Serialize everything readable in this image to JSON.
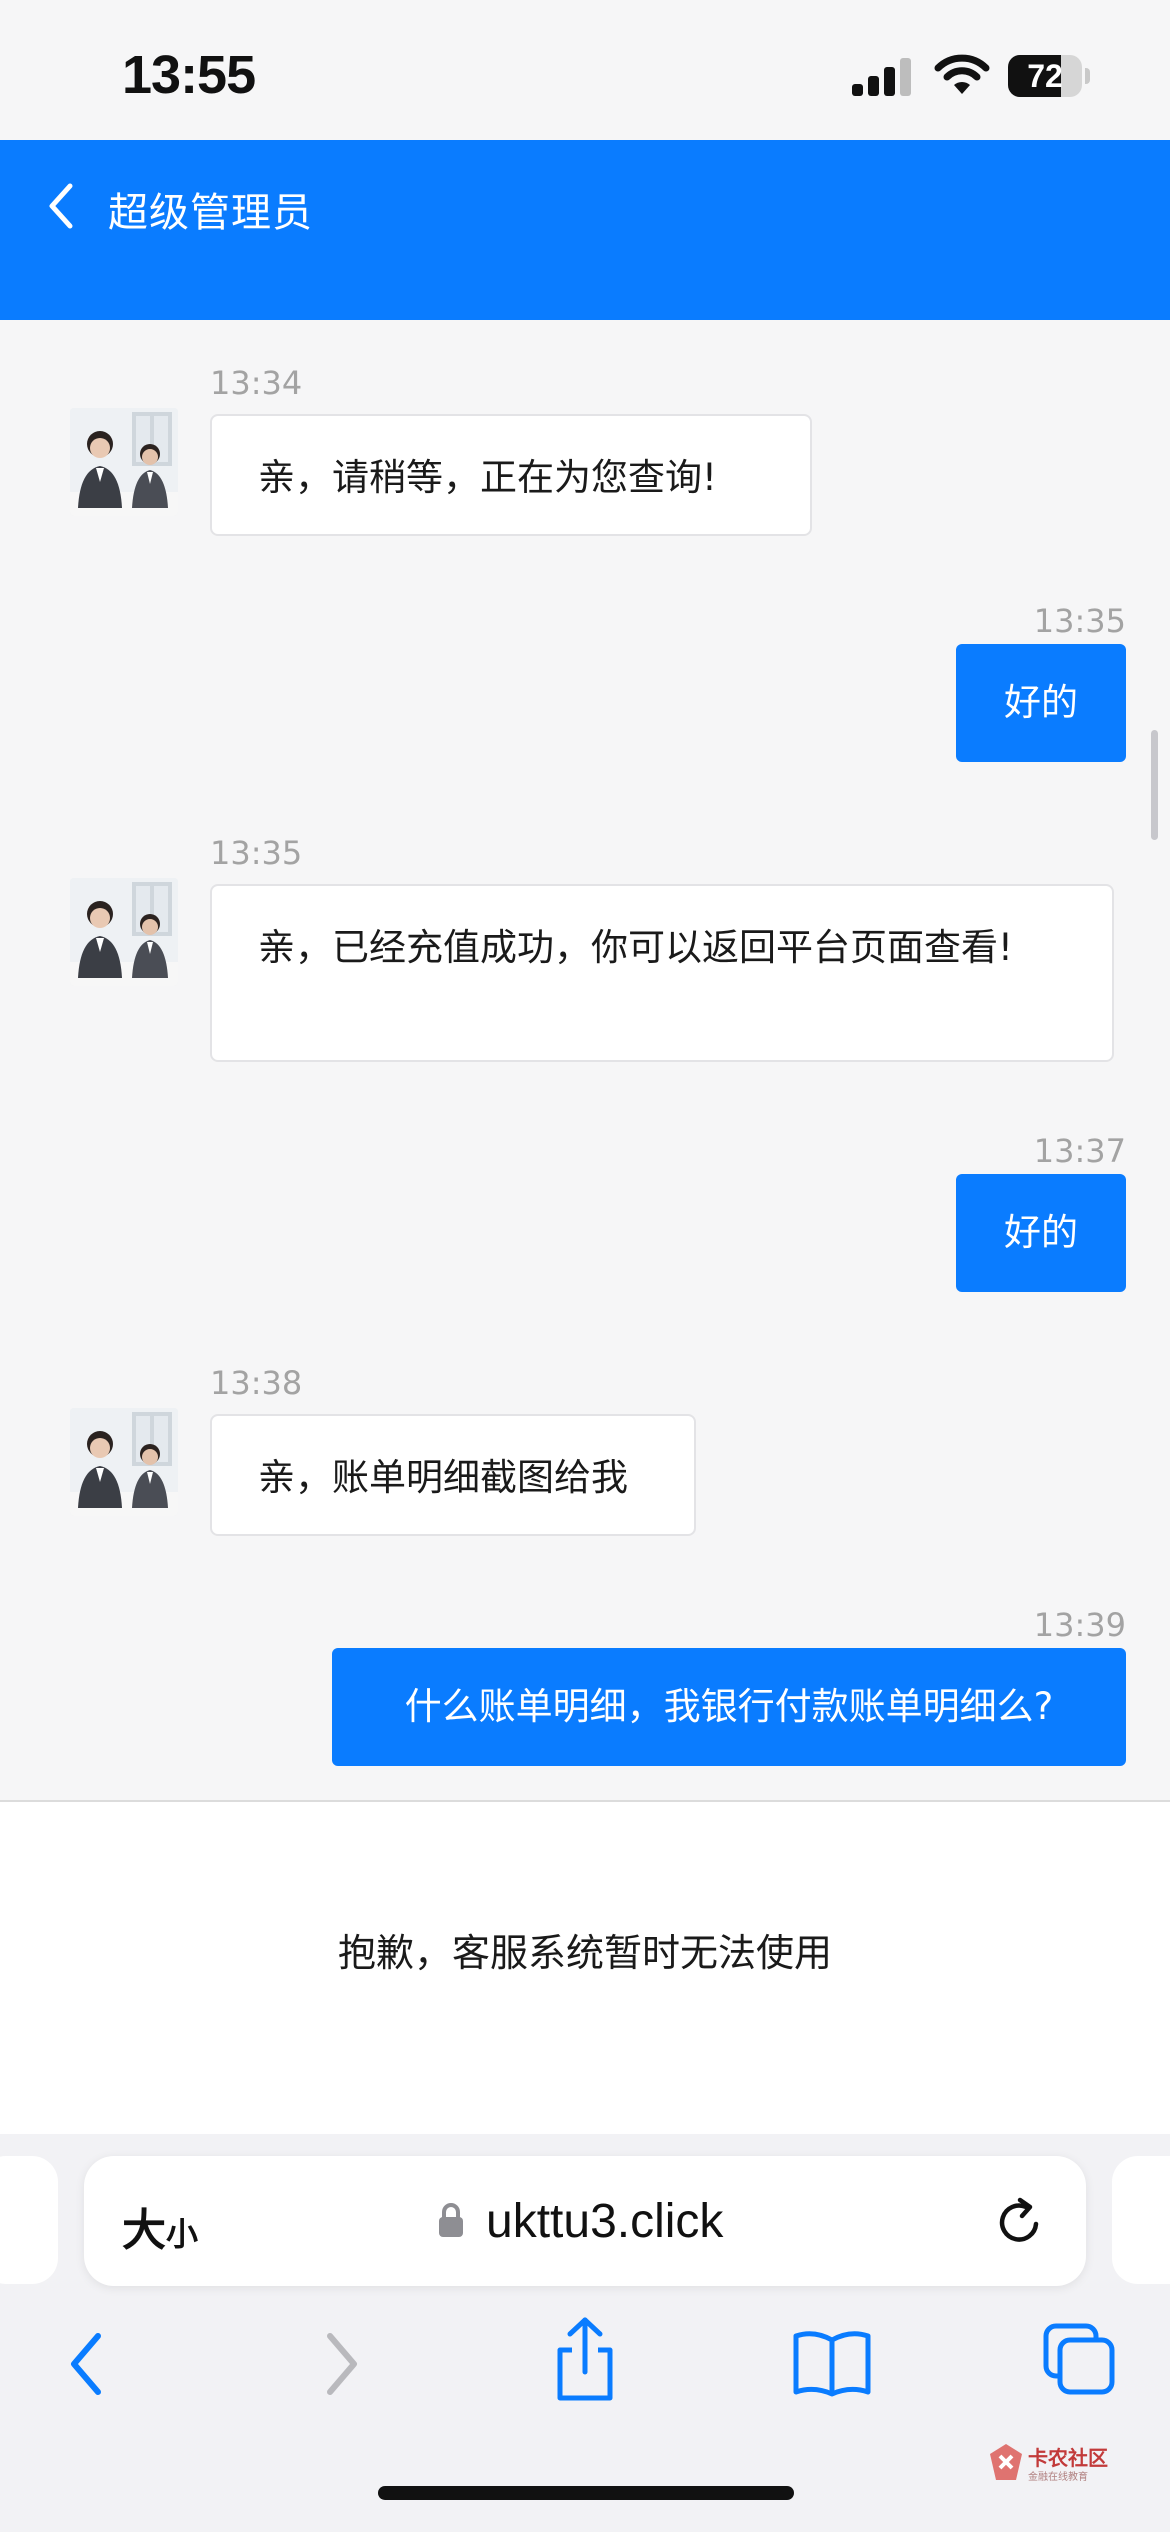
{
  "status_bar": {
    "time": "13:55",
    "battery": "72",
    "battery_level": 0.72
  },
  "header": {
    "title": "超级管理员"
  },
  "messages": [
    {
      "sender": "agent",
      "time": "13:34",
      "text": "亲，请稍等，正在为您查询!"
    },
    {
      "sender": "user",
      "time": "13:35",
      "text": "好的"
    },
    {
      "sender": "agent",
      "time": "13:35",
      "text": "亲，已经充值成功，你可以返回平台页面查看!"
    },
    {
      "sender": "user",
      "time": "13:37",
      "text": "好的"
    },
    {
      "sender": "agent",
      "time": "13:38",
      "text": "亲，账单明细截图给我"
    },
    {
      "sender": "user",
      "time": "13:39",
      "text": "什么账单明细，我银行付款账单明细么?"
    }
  ],
  "notice": {
    "text": "抱歉，客服系统暂时无法使用"
  },
  "browser": {
    "text_size_big": "大",
    "text_size_small": "小",
    "url": "ukttu3.click"
  },
  "watermark": {
    "name": "卡农社区",
    "tagline": "金融在线教育"
  },
  "colors": {
    "accent": "#0a7cff",
    "icon_blue": "#0a7cff",
    "background": "#f6f6f7"
  }
}
